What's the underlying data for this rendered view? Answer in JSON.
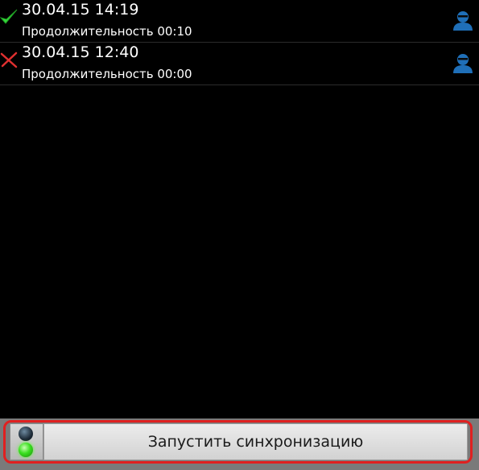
{
  "calls": [
    {
      "status": "success",
      "status_icon": "checkmark-icon",
      "status_color": "#35d63a",
      "datetime": "30.04.15 14:19",
      "duration": "Продолжительность 00:10",
      "contact_icon": "user-avatar-icon"
    },
    {
      "status": "failed",
      "status_icon": "cross-icon",
      "status_color": "#e03030",
      "datetime": "30.04.15 12:40",
      "duration": "Продолжительность 00:00",
      "contact_icon": "user-avatar-icon"
    }
  ],
  "sync": {
    "button_label": "Запустить синхронизацию",
    "indicator_state": "green",
    "highlight_color": "#e02020"
  },
  "colors": {
    "background": "#000000",
    "contact_icon": "#1f6fb8"
  }
}
